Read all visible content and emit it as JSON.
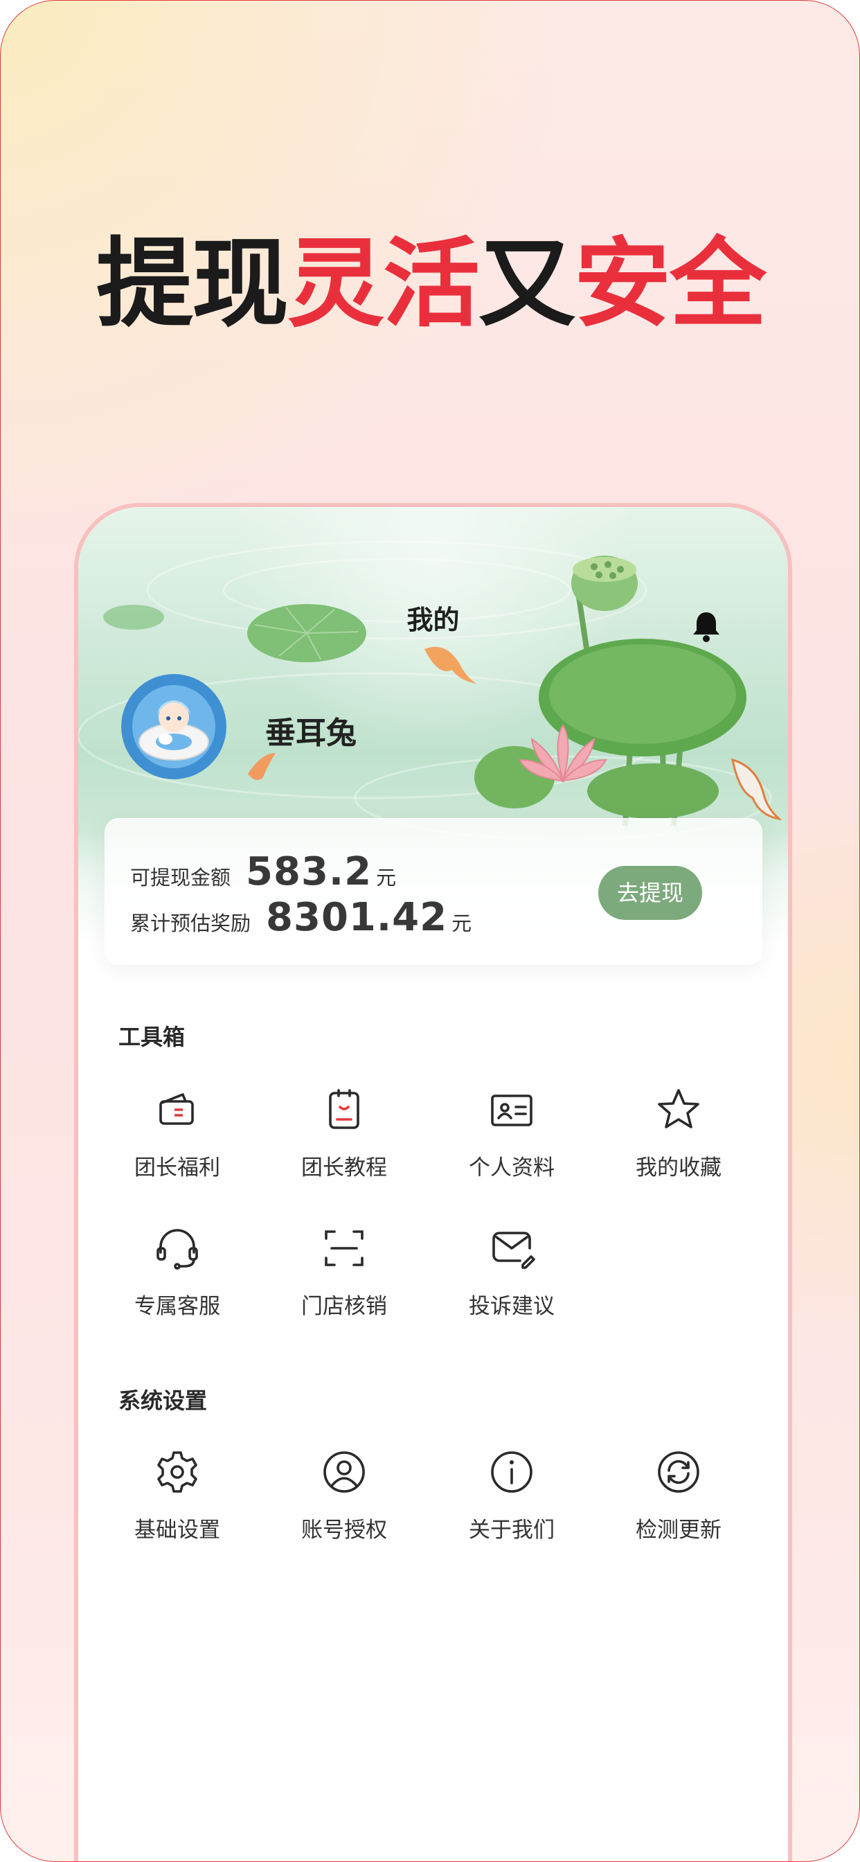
{
  "headline": {
    "part1": "提现",
    "part2": "灵活",
    "part3": "又",
    "part4": "安全"
  },
  "page": {
    "title": "我的"
  },
  "user": {
    "name": "垂耳兔"
  },
  "earnings": {
    "withdrawable_label": "可提现金额",
    "withdrawable_value": "583.2",
    "total_label": "累计预估奖励",
    "total_value": "8301.42",
    "unit": "元",
    "withdraw_button": "去提现"
  },
  "toolbox": {
    "title": "工具箱",
    "items": [
      {
        "label": "团长福利",
        "icon": "wallet-icon"
      },
      {
        "label": "团长教程",
        "icon": "clipboard-icon"
      },
      {
        "label": "个人资料",
        "icon": "id-card-icon"
      },
      {
        "label": "我的收藏",
        "icon": "star-icon"
      },
      {
        "label": "专属客服",
        "icon": "headset-icon"
      },
      {
        "label": "门店核销",
        "icon": "scan-icon"
      },
      {
        "label": "投诉建议",
        "icon": "feedback-icon"
      }
    ]
  },
  "settings": {
    "title": "系统设置",
    "items": [
      {
        "label": "基础设置",
        "icon": "gear-icon"
      },
      {
        "label": "账号授权",
        "icon": "user-circle-icon"
      },
      {
        "label": "关于我们",
        "icon": "info-icon"
      },
      {
        "label": "检测更新",
        "icon": "refresh-icon"
      }
    ]
  },
  "colors": {
    "accent_red": "#ea2f3c",
    "button_green": "#7daa7c",
    "card_border": "#f8c0c0"
  }
}
